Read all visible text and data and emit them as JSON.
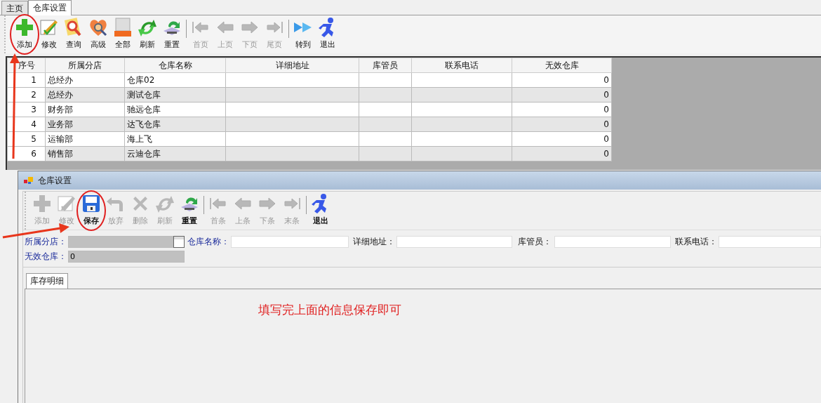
{
  "tabs": [
    {
      "label": "主页",
      "selected": false
    },
    {
      "label": "仓库设置",
      "selected": true
    }
  ],
  "toolbar": [
    {
      "kind": "button",
      "label": "添加",
      "disabled": false,
      "circled": true
    },
    {
      "kind": "button",
      "label": "修改",
      "disabled": false,
      "circled": false
    },
    {
      "kind": "button",
      "label": "查询",
      "disabled": false,
      "circled": false
    },
    {
      "kind": "button",
      "label": "高级",
      "disabled": false,
      "circled": false
    },
    {
      "kind": "button",
      "label": "全部",
      "disabled": false,
      "circled": false
    },
    {
      "kind": "button",
      "label": "刷新",
      "disabled": false,
      "circled": false
    },
    {
      "kind": "button",
      "label": "重置",
      "disabled": false,
      "circled": false
    },
    {
      "kind": "separator"
    },
    {
      "kind": "button",
      "label": "首页",
      "disabled": true,
      "circled": false
    },
    {
      "kind": "button",
      "label": "上页",
      "disabled": true,
      "circled": false
    },
    {
      "kind": "button",
      "label": "下页",
      "disabled": true,
      "circled": false
    },
    {
      "kind": "button",
      "label": "尾页",
      "disabled": true,
      "circled": false
    },
    {
      "kind": "separator"
    },
    {
      "kind": "button",
      "label": "转到",
      "disabled": false,
      "circled": false
    },
    {
      "kind": "button",
      "label": "退出",
      "disabled": false,
      "circled": false
    }
  ],
  "table": {
    "columns": [
      "序号",
      "所属分店",
      "仓库名称",
      "详细地址",
      "库管员",
      "联系电话",
      "无效仓库"
    ],
    "rows": [
      [
        "1",
        "总经办",
        "仓库02",
        "",
        "",
        "",
        "0"
      ],
      [
        "2",
        "总经办",
        "测试仓库",
        "",
        "",
        "",
        "0"
      ],
      [
        "3",
        "财务部",
        "驰远仓库",
        "",
        "",
        "",
        "0"
      ],
      [
        "4",
        "业务部",
        "达飞仓库",
        "",
        "",
        "",
        "0"
      ],
      [
        "5",
        "运输部",
        "海上飞",
        "",
        "",
        "",
        "0"
      ],
      [
        "6",
        "销售部",
        "云迪仓库",
        "",
        "",
        "",
        "0"
      ]
    ]
  },
  "dialog": {
    "title": "仓库设置",
    "toolbar": [
      {
        "kind": "button",
        "label": "添加",
        "disabled": true,
        "circled": false
      },
      {
        "kind": "button",
        "label": "修改",
        "disabled": true,
        "circled": false
      },
      {
        "kind": "button",
        "label": "保存",
        "disabled": false,
        "circled": true
      },
      {
        "kind": "button",
        "label": "放弃",
        "disabled": true,
        "circled": false
      },
      {
        "kind": "button",
        "label": "删除",
        "disabled": true,
        "circled": false
      },
      {
        "kind": "button",
        "label": "刷新",
        "disabled": true,
        "circled": false
      },
      {
        "kind": "button",
        "label": "重置",
        "disabled": false,
        "circled": false
      },
      {
        "kind": "separator"
      },
      {
        "kind": "button",
        "label": "首条",
        "disabled": true,
        "circled": false
      },
      {
        "kind": "button",
        "label": "上条",
        "disabled": true,
        "circled": false
      },
      {
        "kind": "button",
        "label": "下条",
        "disabled": true,
        "circled": false
      },
      {
        "kind": "button",
        "label": "末条",
        "disabled": true,
        "circled": false
      },
      {
        "kind": "separator"
      },
      {
        "kind": "button",
        "label": "退出",
        "disabled": false,
        "circled": false
      }
    ],
    "form_rows": [
      [
        {
          "label": "所属分店：",
          "highlighted": true,
          "kind": "lookup",
          "readonly": true
        },
        {
          "label": "仓库名称：",
          "highlighted": true,
          "kind": "text",
          "readonly": false
        },
        {
          "label": "详细地址：",
          "highlighted": false,
          "kind": "text",
          "readonly": false
        },
        {
          "label": "库管员：",
          "highlighted": false,
          "kind": "text",
          "readonly": false
        },
        {
          "label": "联系电话：",
          "highlighted": false,
          "kind": "text",
          "readonly": false
        }
      ],
      [
        {
          "label": "无效仓库：",
          "highlighted": true,
          "kind": "text",
          "readonly": true,
          "value": "0"
        }
      ]
    ],
    "detail_tabs": [
      {
        "label": "库存明细",
        "selected": true
      }
    ],
    "note": "填写完上面的信息保存即可"
  }
}
